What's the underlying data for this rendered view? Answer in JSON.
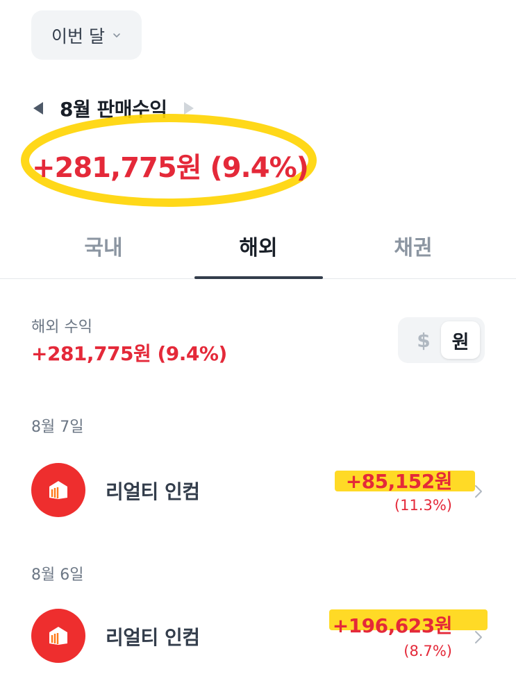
{
  "period_selector": {
    "label": "이번 달",
    "icon": "chevron-down-icon"
  },
  "month_nav": {
    "title": "8월 판매수익",
    "prev_icon": "triangle-left-icon",
    "next_icon": "triangle-right-icon"
  },
  "headline_profit": "+281,775원 (9.4%)",
  "tabs": [
    {
      "label": "국내",
      "active": false
    },
    {
      "label": "해외",
      "active": true
    },
    {
      "label": "채권",
      "active": false
    }
  ],
  "summary": {
    "label": "해외 수익",
    "value": "+281,775원 (9.4%)"
  },
  "currency_toggle": {
    "dollar": "$",
    "won": "원",
    "selected": "원"
  },
  "entries": [
    {
      "date": "8월 7일",
      "name": "리얼티 인컴",
      "amount": "+85,152원",
      "percent": "(11.3%)"
    },
    {
      "date": "8월 6일",
      "name": "리얼티 인컴",
      "amount": "+196,623원",
      "percent": "(8.7%)"
    }
  ],
  "colors": {
    "profit": "#e42939",
    "highlight": "#ffd400",
    "logo_bg": "#ee2e2e",
    "text_primary": "#191f28",
    "text_secondary": "#6b7684"
  }
}
